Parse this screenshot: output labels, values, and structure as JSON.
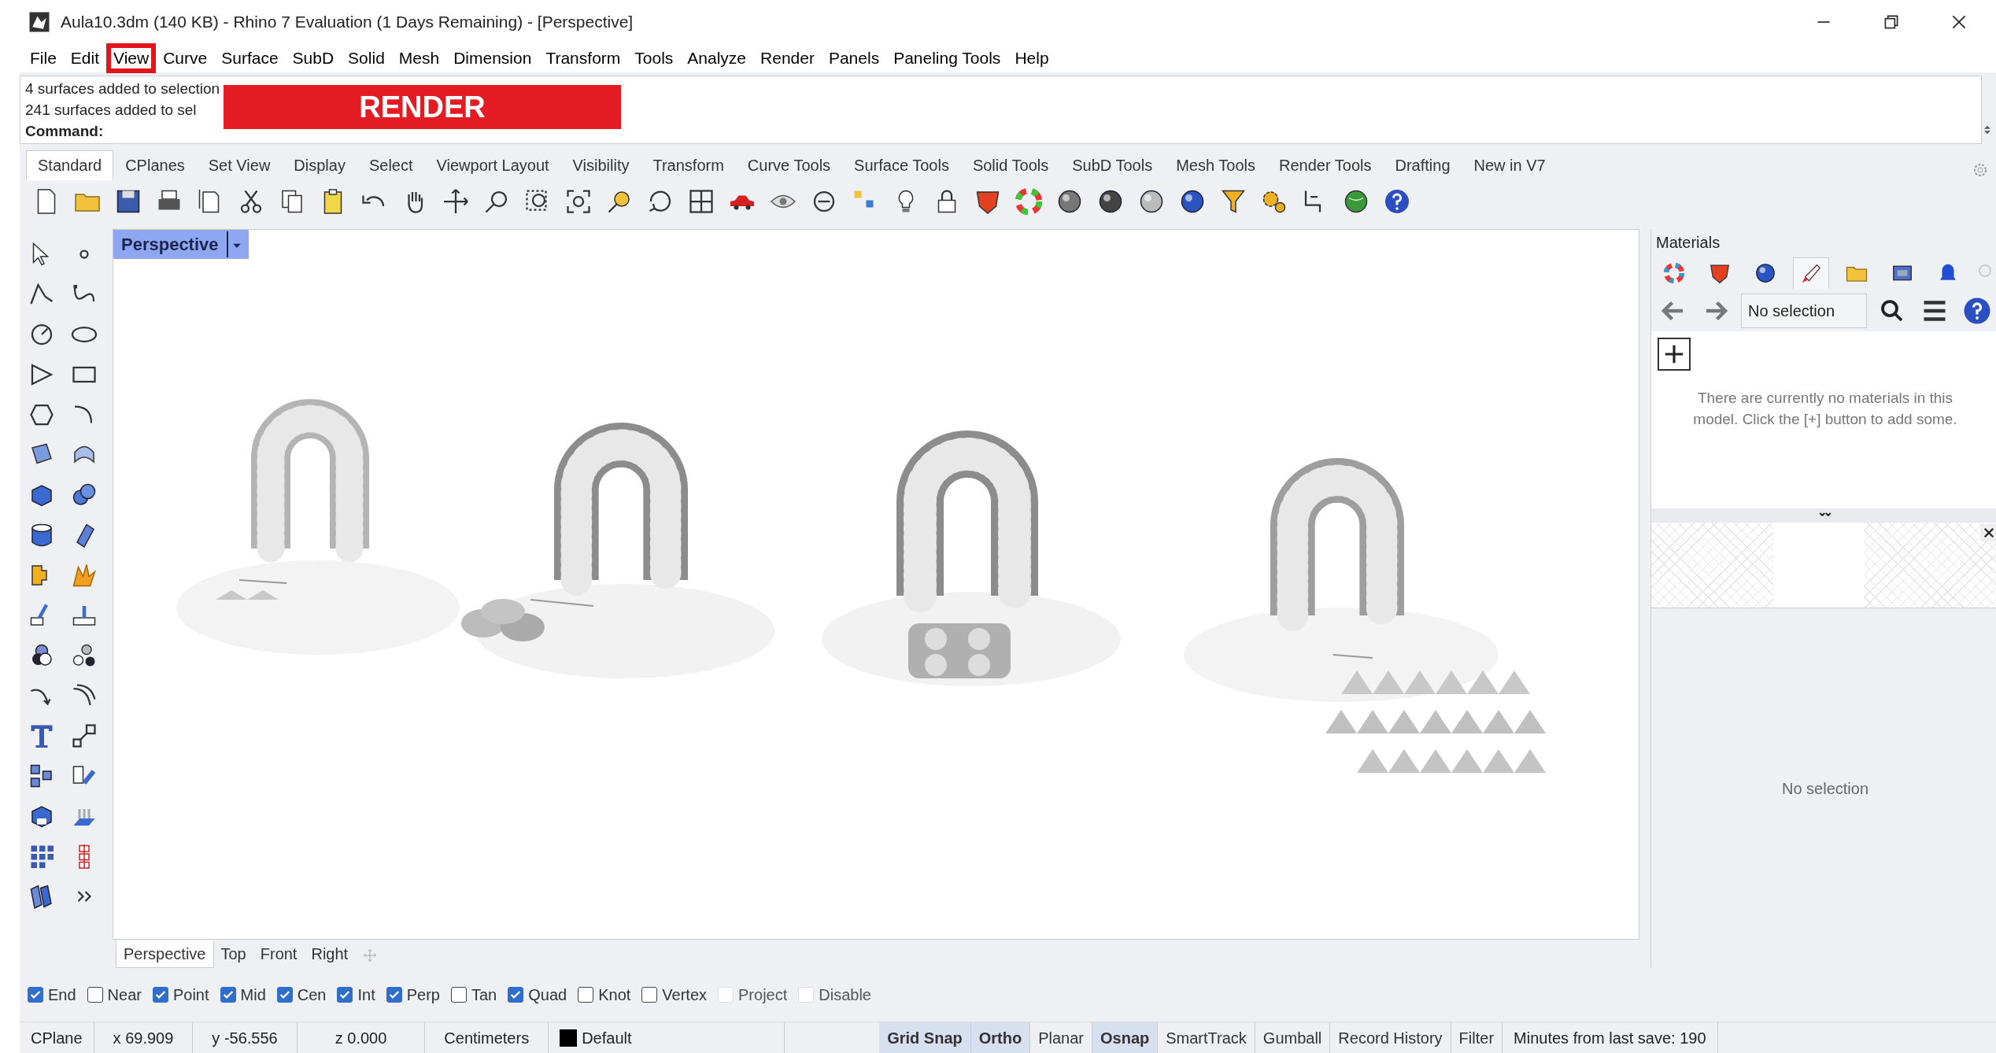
{
  "window": {
    "title": "Aula10.3dm (140 KB) - Rhino 7 Evaluation (1 Days Remaining) - [Perspective]"
  },
  "menu": [
    {
      "label": "File",
      "highlighted": false
    },
    {
      "label": "Edit",
      "highlighted": false
    },
    {
      "label": "View",
      "highlighted": true
    },
    {
      "label": "Curve",
      "highlighted": false
    },
    {
      "label": "Surface",
      "highlighted": false
    },
    {
      "label": "SubD",
      "highlighted": false
    },
    {
      "label": "Solid",
      "highlighted": false
    },
    {
      "label": "Mesh",
      "highlighted": false
    },
    {
      "label": "Dimension",
      "highlighted": false
    },
    {
      "label": "Transform",
      "highlighted": false
    },
    {
      "label": "Tools",
      "highlighted": false
    },
    {
      "label": "Analyze",
      "highlighted": false
    },
    {
      "label": "Render",
      "highlighted": false
    },
    {
      "label": "Panels",
      "highlighted": false
    },
    {
      "label": "Paneling Tools",
      "highlighted": false
    },
    {
      "label": "Help",
      "highlighted": false
    }
  ],
  "command_history": [
    "4 surfaces added to selection",
    "241 surfaces added to sel"
  ],
  "annotation_banner": "RENDER",
  "command": {
    "label": "Command:"
  },
  "toolbar_tabs": [
    {
      "label": "Standard",
      "selected": true
    },
    {
      "label": "CPlanes",
      "selected": false
    },
    {
      "label": "Set View",
      "selected": false
    },
    {
      "label": "Display",
      "selected": false
    },
    {
      "label": "Select",
      "selected": false
    },
    {
      "label": "Viewport Layout",
      "selected": false
    },
    {
      "label": "Visibility",
      "selected": false
    },
    {
      "label": "Transform",
      "selected": false
    },
    {
      "label": "Curve Tools",
      "selected": false
    },
    {
      "label": "Surface Tools",
      "selected": false
    },
    {
      "label": "Solid Tools",
      "selected": false
    },
    {
      "label": "SubD Tools",
      "selected": false
    },
    {
      "label": "Mesh Tools",
      "selected": false
    },
    {
      "label": "Render Tools",
      "selected": false
    },
    {
      "label": "Drafting",
      "selected": false
    },
    {
      "label": "New in V7",
      "selected": false
    }
  ],
  "viewport": {
    "title": "Perspective",
    "tabs": [
      {
        "label": "Perspective",
        "selected": true
      },
      {
        "label": "Top",
        "selected": false
      },
      {
        "label": "Front",
        "selected": false
      },
      {
        "label": "Right",
        "selected": false
      }
    ]
  },
  "materials_panel": {
    "title": "Materials",
    "icon_tabs": [
      {
        "selected": false
      },
      {
        "selected": false
      },
      {
        "selected": false
      },
      {
        "selected": true
      },
      {
        "selected": false
      },
      {
        "selected": false
      },
      {
        "selected": false
      }
    ],
    "selector": {
      "value": "No selection"
    },
    "empty_message": "There are currently no materials in this model. Click the [+] button to add some.",
    "properties_message": "No selection"
  },
  "osnaps": [
    {
      "label": "End",
      "checked": true,
      "disabled": false
    },
    {
      "label": "Near",
      "checked": false,
      "disabled": false
    },
    {
      "label": "Point",
      "checked": true,
      "disabled": false
    },
    {
      "label": "Mid",
      "checked": true,
      "disabled": false
    },
    {
      "label": "Cen",
      "checked": true,
      "disabled": false
    },
    {
      "label": "Int",
      "checked": true,
      "disabled": false
    },
    {
      "label": "Perp",
      "checked": true,
      "disabled": false
    },
    {
      "label": "Tan",
      "checked": false,
      "disabled": false
    },
    {
      "label": "Quad",
      "checked": true,
      "disabled": false
    },
    {
      "label": "Knot",
      "checked": false,
      "disabled": false
    },
    {
      "label": "Vertex",
      "checked": false,
      "disabled": false
    },
    {
      "label": "Project",
      "checked": false,
      "disabled": true
    },
    {
      "label": "Disable",
      "checked": false,
      "disabled": true
    }
  ],
  "status_bar": {
    "cplane": "CPlane",
    "x": "x 69.909",
    "y": "y -56.556",
    "z": "z 0.000",
    "units": "Centimeters",
    "layer": "Default",
    "toggles": [
      {
        "label": "Grid Snap",
        "on": true
      },
      {
        "label": "Ortho",
        "on": true
      },
      {
        "label": "Planar",
        "on": false
      },
      {
        "label": "Osnap",
        "on": true
      },
      {
        "label": "SmartTrack",
        "on": false
      },
      {
        "label": "Gumball",
        "on": false
      },
      {
        "label": "Record History",
        "on": false
      },
      {
        "label": "Filter",
        "on": false
      }
    ],
    "save_info": "Minutes from last save: 190"
  }
}
